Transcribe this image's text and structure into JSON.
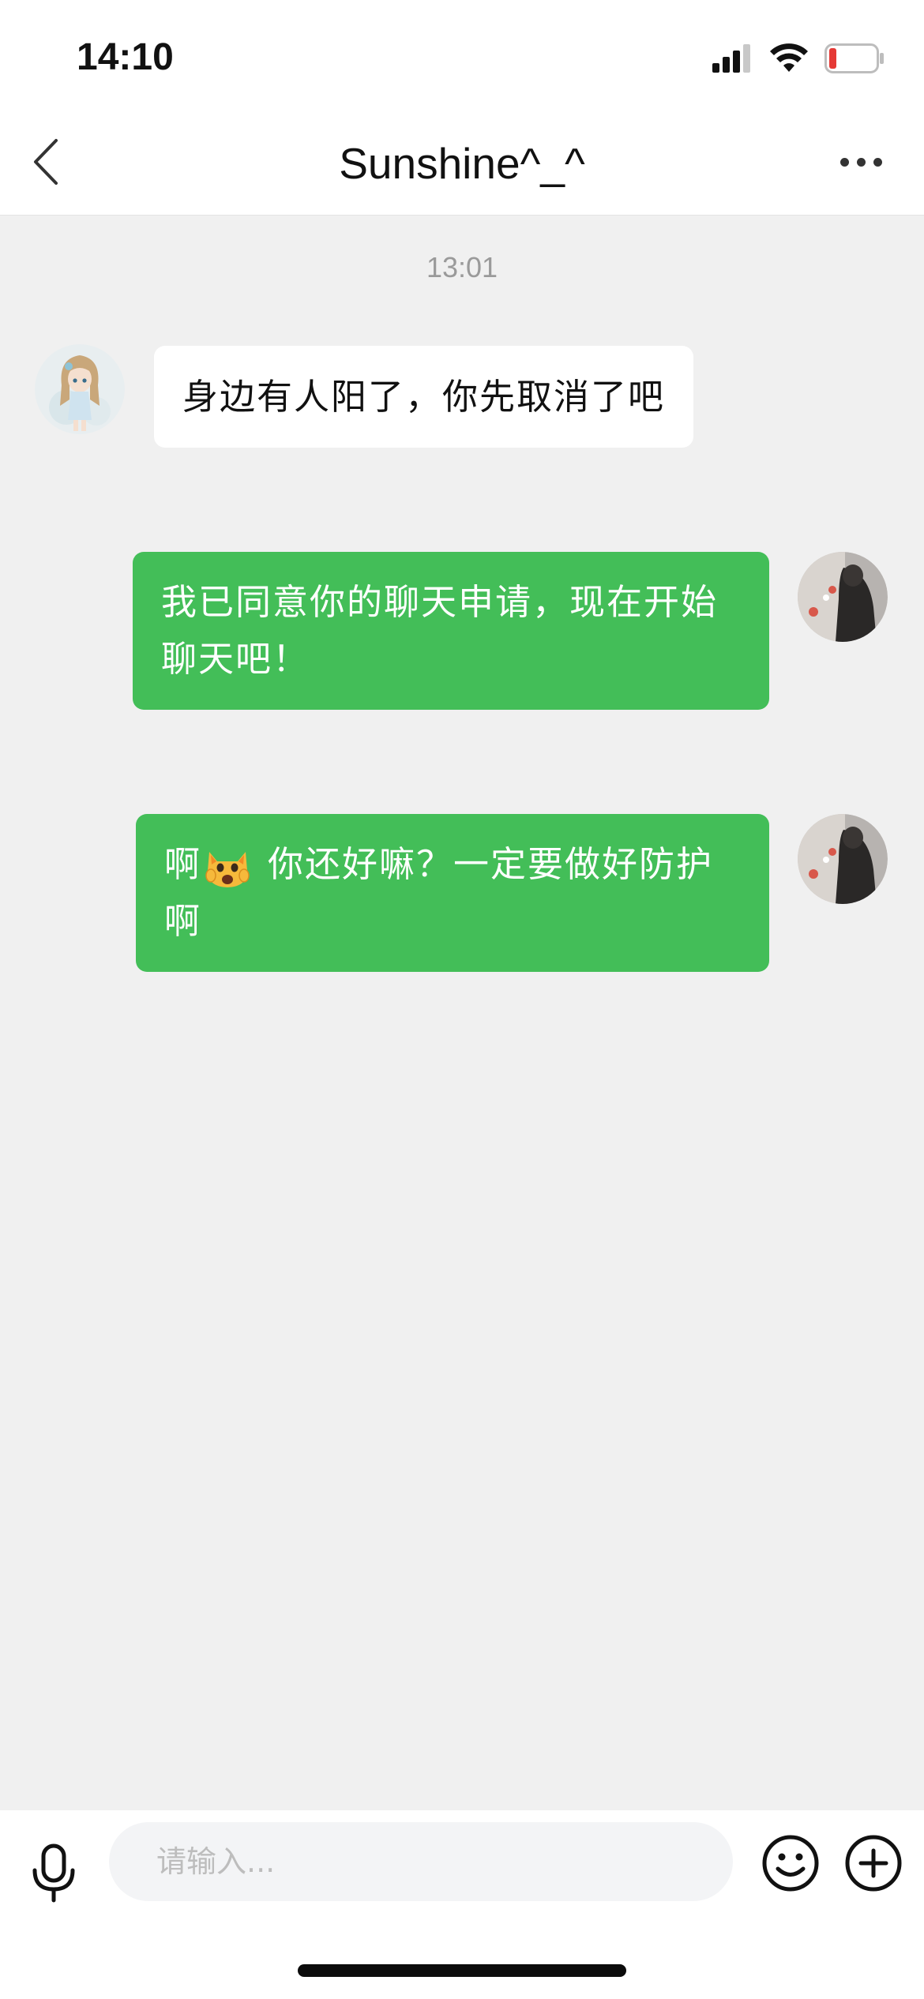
{
  "status_bar": {
    "time": "14:10",
    "signal_icon": "cellular-signal-icon",
    "wifi_icon": "wifi-icon",
    "battery_icon": "battery-low-icon",
    "battery_color": "#e53935"
  },
  "nav": {
    "back_icon": "chevron-left-icon",
    "title": "Sunshine^_^",
    "more_icon": "more-dots-icon"
  },
  "chat": {
    "timestamp": "13:01",
    "messages": [
      {
        "direction": "incoming",
        "avatar_icon": "anime-girl-avatar",
        "text": "身边有人阳了，你先取消了吧"
      },
      {
        "direction": "outgoing",
        "avatar_icon": "user-avatar",
        "text": "我已同意你的聊天申请，现在开始聊天吧！"
      },
      {
        "direction": "outgoing",
        "avatar_icon": "user-avatar",
        "prefix": "啊",
        "emoji": "weary-cat-face-emoji",
        "text": "你还好嘛？一定要做好防护啊"
      }
    ]
  },
  "input_bar": {
    "mic_icon": "microphone-icon",
    "placeholder": "请输入...",
    "emoji_icon": "smiley-face-icon",
    "plus_icon": "plus-circle-icon"
  },
  "colors": {
    "bubble_out": "#43be58",
    "bubble_in": "#ffffff",
    "chat_bg": "#f0f0f0"
  }
}
